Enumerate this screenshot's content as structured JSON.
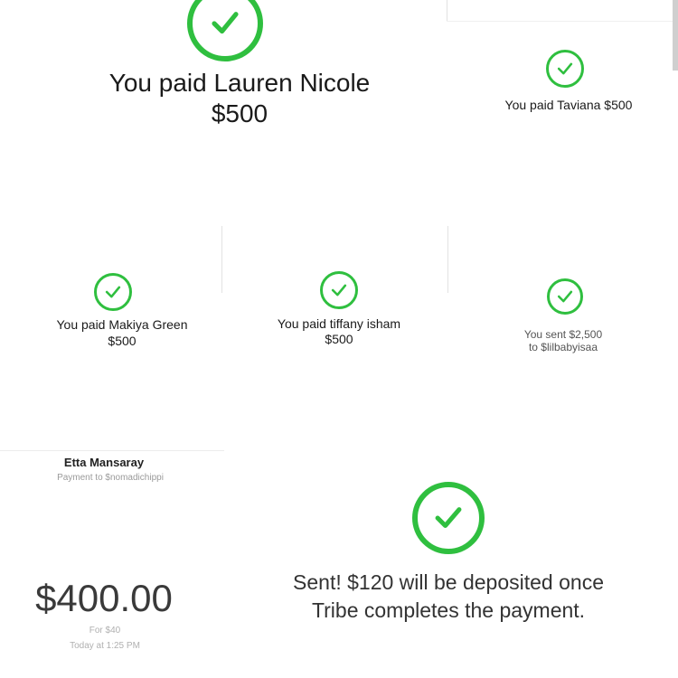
{
  "receipts": [
    {
      "line1": "You paid Lauren Nicole",
      "line2": "$500"
    },
    {
      "line1": "You paid Taviana $500"
    },
    {
      "line1": "You paid Makiya Green",
      "line2": "$500"
    },
    {
      "line1": "You paid tiffany isham",
      "line2": "$500"
    },
    {
      "line1": "You sent $2,500",
      "line2": "to $lilbabyisaa"
    }
  ],
  "payment_card": {
    "name": "Etta Mansaray",
    "subtitle": "Payment to $nomadichippi",
    "amount": "$400.00",
    "for": "For $40",
    "time": "Today at 1:25 PM"
  },
  "sent_message": {
    "line1": "Sent! $120 will be deposited once",
    "line2": "Tribe completes the payment."
  },
  "colors": {
    "accent": "#2fbf3f"
  },
  "icons": [
    "check-circle-icon"
  ]
}
